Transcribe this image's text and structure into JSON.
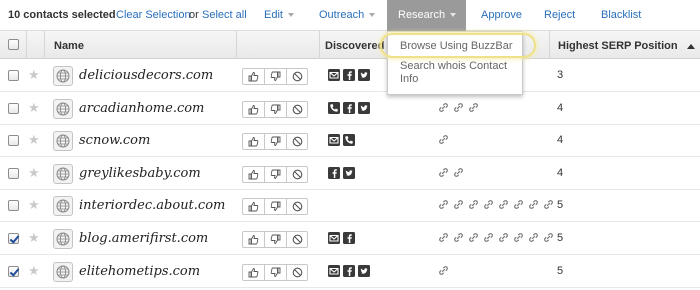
{
  "toolbar": {
    "selected_count": "10 contacts selected",
    "clear_selection": "Clear Selection",
    "or": "or",
    "select_all": "Select all",
    "edit": "Edit",
    "outreach": "Outreach",
    "research": "Research",
    "approve": "Approve",
    "reject": "Reject",
    "blacklist": "Blacklist"
  },
  "header": {
    "name": "Name",
    "discovered": "Discovered C",
    "serp": "Highest SERP Position"
  },
  "research_menu": {
    "items": [
      "Browse Using BuzzBar",
      "Search whois Contact",
      "Info"
    ]
  },
  "rows": [
    {
      "domain": "deliciousdecors.com",
      "checked": false,
      "rank": "3",
      "social": [
        "mail-icon",
        "facebook-icon",
        "twitter-icon"
      ],
      "links": 0
    },
    {
      "domain": "arcadianhome.com",
      "checked": false,
      "rank": "4",
      "social": [
        "phone-icon",
        "facebook-icon",
        "twitter-icon"
      ],
      "links": 3
    },
    {
      "domain": "scnow.com",
      "checked": false,
      "rank": "4",
      "social": [
        "mail-icon",
        "phone-icon"
      ],
      "links": 1
    },
    {
      "domain": "greylikesbaby.com",
      "checked": false,
      "rank": "4",
      "social": [
        "facebook-icon",
        "twitter-icon"
      ],
      "links": 2
    },
    {
      "domain": "interiordec.about.com",
      "checked": false,
      "rank": "5",
      "social": [],
      "links": 8
    },
    {
      "domain": "blog.amerifirst.com",
      "checked": true,
      "rank": "5",
      "social": [
        "mail-icon",
        "facebook-icon"
      ],
      "links": 8
    },
    {
      "domain": "elitehometips.com",
      "checked": true,
      "rank": "5",
      "social": [
        "mail-icon",
        "facebook-icon",
        "twitter-icon"
      ],
      "links": 1
    }
  ],
  "colors": {
    "link": "#2a6ebb",
    "research_bg": "#9a9a9a",
    "highlight": "#efe08a"
  }
}
